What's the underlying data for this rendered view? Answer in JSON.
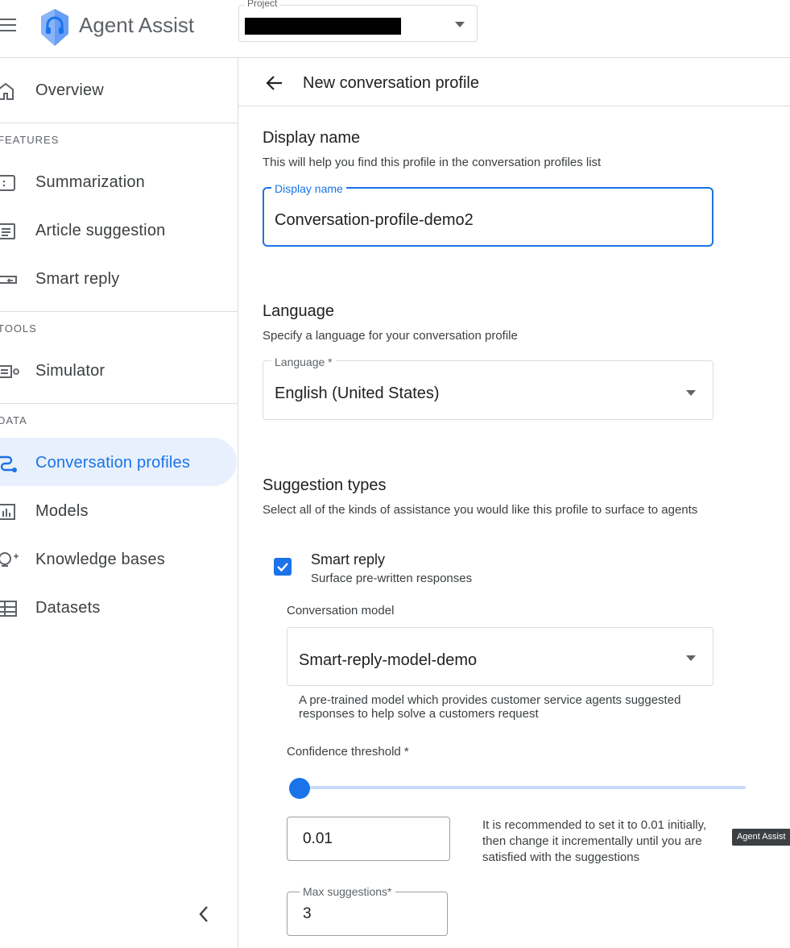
{
  "header": {
    "app_title": "Agent Assist",
    "project_label": "Project"
  },
  "sidebar": {
    "items": [
      {
        "label": "Overview"
      },
      {
        "label": "Summarization"
      },
      {
        "label": "Article suggestion"
      },
      {
        "label": "Smart reply"
      },
      {
        "label": "Simulator"
      },
      {
        "label": "Conversation profiles",
        "active": true
      },
      {
        "label": "Models"
      },
      {
        "label": "Knowledge bases"
      },
      {
        "label": "Datasets"
      }
    ],
    "sections": [
      "FEATURES",
      "TOOLS",
      "DATA"
    ]
  },
  "main": {
    "page_title": "New conversation profile",
    "display_name": {
      "heading": "Display name",
      "description": "This will help you find this profile in the conversation profiles list",
      "field_label": "Display name",
      "value": "Conversation-profile-demo2"
    },
    "language": {
      "heading": "Language",
      "description": "Specify a language for your conversation profile",
      "field_label": "Language *",
      "value": "English (United States)"
    },
    "suggestion_types": {
      "heading": "Suggestion types",
      "description": "Select all of the kinds of assistance you would like this profile to surface to agents",
      "smart_reply": {
        "checked": true,
        "title": "Smart reply",
        "subtitle": "Surface pre-written responses",
        "model_caption": "Conversation model",
        "model_value": "Smart-reply-model-demo",
        "model_hint": "A pre-trained model which provides customer service agents suggested responses to help solve a customers request",
        "threshold_caption": "Confidence threshold *",
        "threshold_value": "0.01",
        "threshold_slider_level": 0.01,
        "threshold_hint": "It is recommended to set it to 0.01 initially, then change it incrementally until you are satisfied with the suggestions",
        "max_label": "Max suggestions*",
        "max_value": "3"
      }
    }
  },
  "tooltip": "Agent Assist",
  "colors": {
    "accent": "#1a73e8",
    "active_nav_bg": "#e8f0fe",
    "divider": "#dadce0"
  },
  "icons": [
    "menu-icon",
    "agent-assist-logo-icon",
    "caret-down-icon",
    "home-icon",
    "summarization-icon",
    "article-icon",
    "smart-reply-icon",
    "simulator-icon",
    "conversation-profiles-icon",
    "models-icon",
    "knowledge-bases-icon",
    "datasets-icon",
    "back-arrow-icon",
    "chevron-left-icon",
    "checkmark-icon"
  ]
}
